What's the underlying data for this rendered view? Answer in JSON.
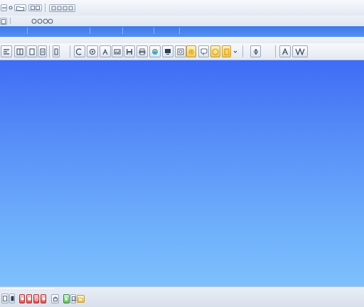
{
  "window": {
    "title": "",
    "menu_items": [
      "",
      "",
      "",
      ""
    ]
  },
  "ribbon": {
    "tabs": [
      {
        "label": ""
      },
      {
        "label": ""
      },
      {
        "label": ""
      },
      {
        "label": ""
      }
    ]
  },
  "toolbar": {
    "buttons": [
      "align-left-icon",
      "columns-icon",
      "page-icon",
      "page-alt-icon",
      "text-cursor-icon",
      "cut-icon",
      "copy-icon",
      "paste-icon",
      "insert-image-icon",
      "save-icon",
      "print-icon",
      "monitor-icon",
      "image-icon",
      "sun-icon",
      "speech-bubble-icon",
      "smiley-icon",
      "arrow-down-icon",
      "marker-icon",
      "text-a-icon",
      "chart-icon"
    ]
  },
  "colors": {
    "canvas_top": "#3f6cf5",
    "canvas_bottom": "#7dc0fc",
    "tab_strip": "#4a83ef"
  }
}
